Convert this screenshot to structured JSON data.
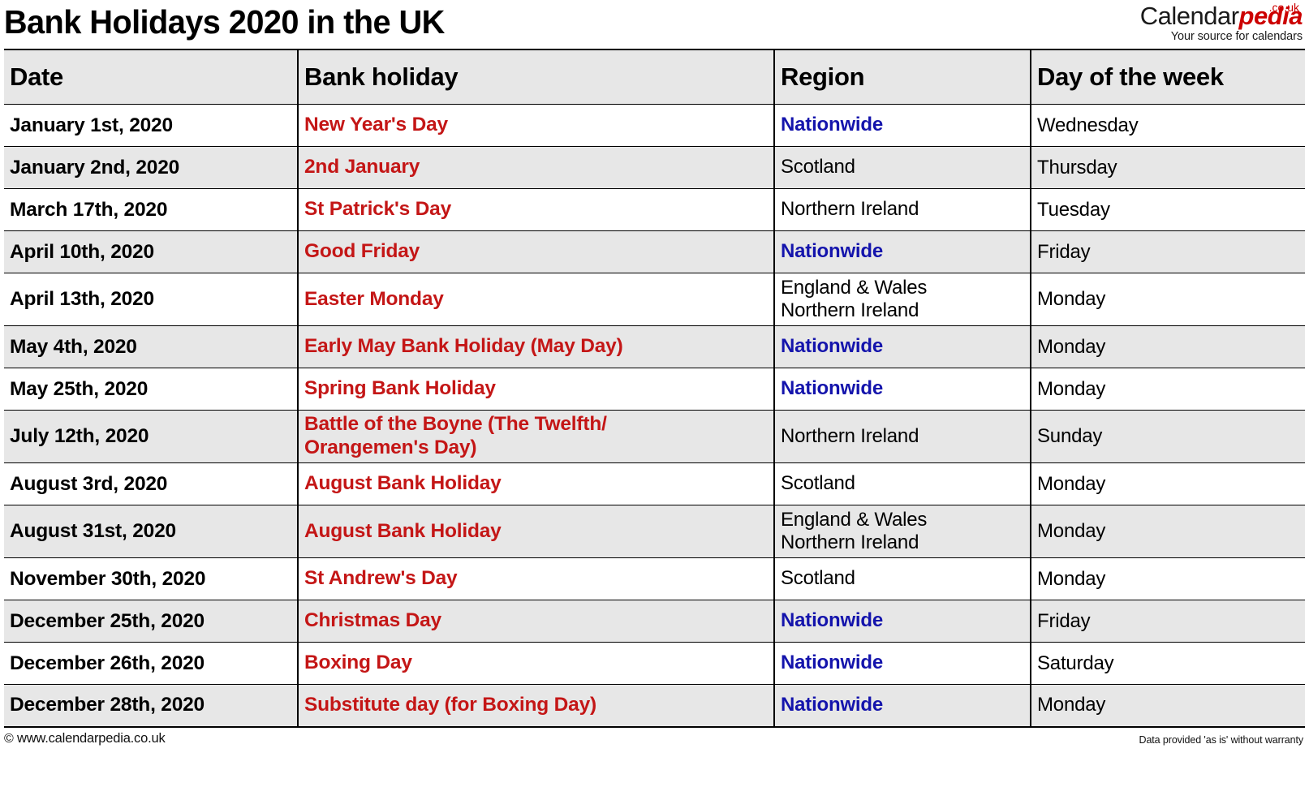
{
  "header": {
    "title": "Bank Holidays 2020 in the UK",
    "logo": {
      "name_part1": "Calendar",
      "name_part2": "pedia",
      "tld": ".co.uk",
      "tagline": "Your source for calendars"
    }
  },
  "table": {
    "columns": [
      "Date",
      "Bank holiday",
      "Region",
      "Day of the week"
    ],
    "rows": [
      {
        "date": "January 1st, 2020",
        "holiday": "New Year's Day",
        "region": "Nationwide",
        "region_line2": "",
        "day": "Wednesday",
        "nationwide": true,
        "shaded": false,
        "two_line": false
      },
      {
        "date": "January 2nd, 2020",
        "holiday": "2nd January",
        "region": "Scotland",
        "region_line2": "",
        "day": "Thursday",
        "nationwide": false,
        "shaded": true,
        "two_line": false
      },
      {
        "date": "March 17th, 2020",
        "holiday": "St Patrick's Day",
        "region": "Northern Ireland",
        "region_line2": "",
        "day": "Tuesday",
        "nationwide": false,
        "shaded": false,
        "two_line": false
      },
      {
        "date": "April 10th, 2020",
        "holiday": "Good Friday",
        "region": "Nationwide",
        "region_line2": "",
        "day": "Friday",
        "nationwide": true,
        "shaded": true,
        "two_line": false
      },
      {
        "date": "April 13th, 2020",
        "holiday": "Easter Monday",
        "region": "England & Wales",
        "region_line2": "Northern Ireland",
        "day": "Monday",
        "nationwide": false,
        "shaded": false,
        "two_line": true
      },
      {
        "date": "May 4th, 2020",
        "holiday": "Early May Bank Holiday (May Day)",
        "region": "Nationwide",
        "region_line2": "",
        "day": "Monday",
        "nationwide": true,
        "shaded": true,
        "two_line": false
      },
      {
        "date": "May 25th, 2020",
        "holiday": "Spring Bank Holiday",
        "region": "Nationwide",
        "region_line2": "",
        "day": "Monday",
        "nationwide": true,
        "shaded": false,
        "two_line": false
      },
      {
        "date": "July 12th, 2020",
        "holiday": "Battle of the Boyne (The Twelfth/",
        "holiday_line2": "Orangemen's Day)",
        "region": "Northern Ireland",
        "region_line2": "",
        "day": "Sunday",
        "nationwide": false,
        "shaded": true,
        "two_line": true
      },
      {
        "date": "August 3rd, 2020",
        "holiday": "August Bank Holiday",
        "region": "Scotland",
        "region_line2": "",
        "day": "Monday",
        "nationwide": false,
        "shaded": false,
        "two_line": false
      },
      {
        "date": "August 31st, 2020",
        "holiday": "August Bank Holiday",
        "region": "England & Wales",
        "region_line2": "Northern Ireland",
        "day": "Monday",
        "nationwide": false,
        "shaded": true,
        "two_line": true
      },
      {
        "date": "November 30th, 2020",
        "holiday": "St Andrew's Day",
        "region": "Scotland",
        "region_line2": "",
        "day": "Monday",
        "nationwide": false,
        "shaded": false,
        "two_line": false
      },
      {
        "date": "December 25th, 2020",
        "holiday": "Christmas Day",
        "region": "Nationwide",
        "region_line2": "",
        "day": "Friday",
        "nationwide": true,
        "shaded": true,
        "two_line": false
      },
      {
        "date": "December 26th, 2020",
        "holiday": "Boxing Day",
        "region": "Nationwide",
        "region_line2": "",
        "day": "Saturday",
        "nationwide": true,
        "shaded": false,
        "two_line": false
      },
      {
        "date": "December 28th, 2020",
        "holiday": "Substitute day (for Boxing Day)",
        "region": "Nationwide",
        "region_line2": "",
        "day": "Monday",
        "nationwide": true,
        "shaded": true,
        "two_line": false
      }
    ]
  },
  "footer": {
    "copyright_symbol": "©",
    "copyright": "www.calendarpedia.co.uk",
    "disclaimer": "Data provided 'as is' without warranty"
  },
  "colors": {
    "holiday_red": "#c41616",
    "nationwide_blue": "#1414ac",
    "logo_red": "#cc0000",
    "header_row_bg": "#e7e7e7",
    "alt_row_bg": "#e7e7e7"
  }
}
